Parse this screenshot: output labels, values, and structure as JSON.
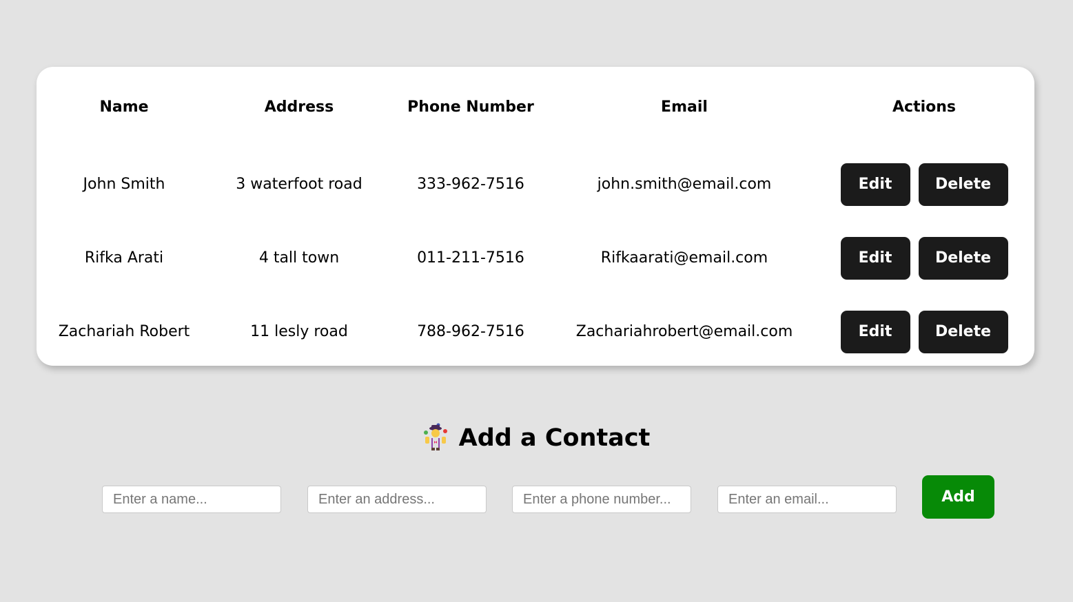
{
  "table": {
    "columns": [
      "Name",
      "Address",
      "Phone Number",
      "Email",
      "Actions"
    ],
    "rows": [
      {
        "name": "John Smith",
        "address": "3 waterfoot road",
        "phone": "333-962-7516",
        "email": "john.smith@email.com"
      },
      {
        "name": "Rifka Arati",
        "address": "4 tall town",
        "phone": "011-211-7516",
        "email": "Rifkaarati@email.com"
      },
      {
        "name": "Zachariah Robert",
        "address": "11 lesly road",
        "phone": "788-962-7516",
        "email": "Zachariahrobert@email.com"
      }
    ],
    "edit_label": "Edit",
    "delete_label": "Delete"
  },
  "add_form": {
    "title": "Add a Contact",
    "title_icon": "juggler-emoji-icon",
    "name_placeholder": "Enter a name...",
    "address_placeholder": "Enter an address...",
    "phone_placeholder": "Enter a phone number...",
    "email_placeholder": "Enter an email...",
    "add_label": "Add"
  },
  "colors": {
    "background": "#e3e3e3",
    "card": "#ffffff",
    "dark_button": "#1b1b1b",
    "add_button": "#078a07"
  }
}
